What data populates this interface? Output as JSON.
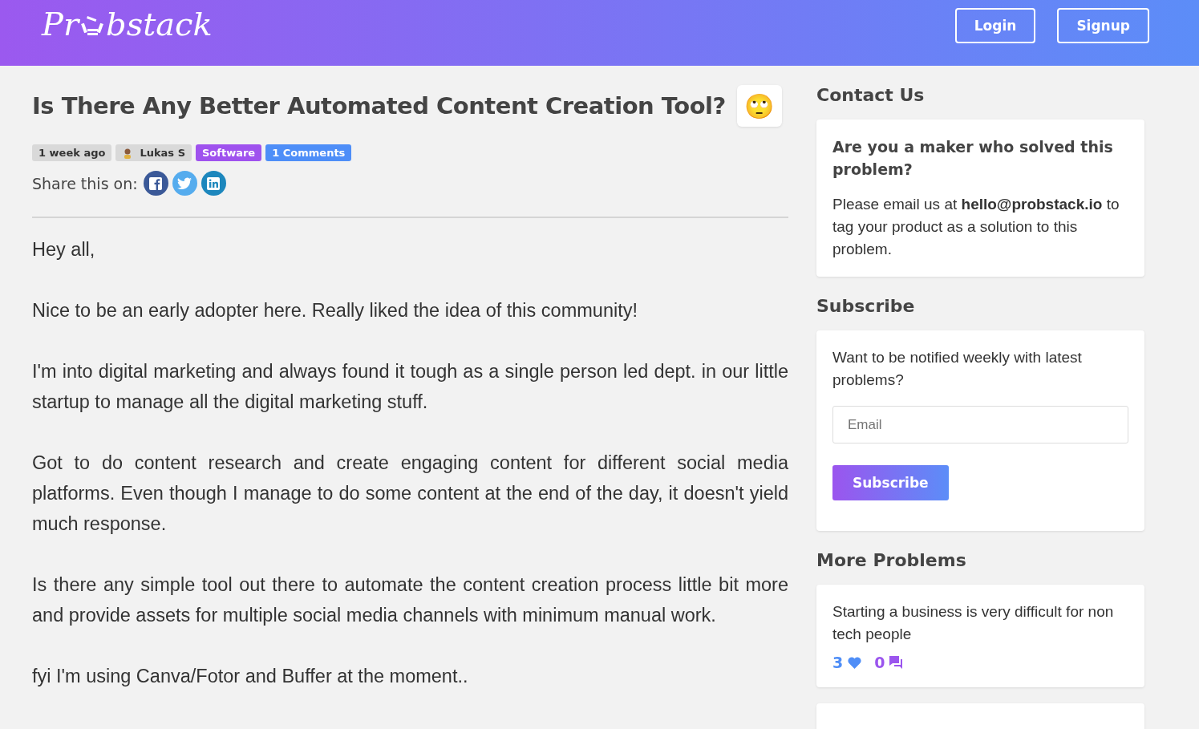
{
  "header": {
    "logo_start": "Pr",
    "logo_end": "bstack",
    "buttons": [
      "Login",
      "Signup"
    ]
  },
  "post": {
    "title": "Is There Any Better Automated Content Creation Tool?",
    "reaction": "🙄",
    "meta": [
      {
        "kind": "time",
        "text": "1 week ago"
      },
      {
        "kind": "author",
        "text": "Lukas S"
      },
      {
        "kind": "category",
        "text": "Software"
      },
      {
        "kind": "comments",
        "text": "1 Comments"
      }
    ],
    "share_label": "Share this on:",
    "share": [
      {
        "kind": "facebook"
      },
      {
        "kind": "twitter"
      },
      {
        "kind": "linkedin"
      }
    ],
    "paragraphs": [
      "Hey all,",
      "Nice to be an early adopter here. Really liked the idea of this community!",
      "I'm into digital marketing and always found it tough as a single person led dept. in our little startup to manage all the digital marketing stuff.",
      "Got to do content research and create engaging content for different social media platforms. Even though I manage to do some content at the end of the day, it doesn't yield much response.",
      "Is there any simple tool out there to automate the content creation process little bit more and provide assets for multiple social media channels with minimum manual work.",
      "fyi I'm using Canva/Fotor and Buffer at the moment.."
    ]
  },
  "sidebar": {
    "contact": {
      "heading": "Contact Us",
      "question": "Are you a maker who solved this problem?",
      "text": "Please email us at **hello@probstack.io** to tag your product as a solution to this problem."
    },
    "subscribe": {
      "heading": "Subscribe",
      "text": "Want to be notified weekly with latest problems?",
      "placeholder": "Email",
      "button": "Subscribe"
    },
    "more": {
      "heading": "More Problems",
      "items": [
        {
          "title": "Starting a business is very difficult for non tech people",
          "likes": "3",
          "comments": "0"
        }
      ]
    }
  }
}
